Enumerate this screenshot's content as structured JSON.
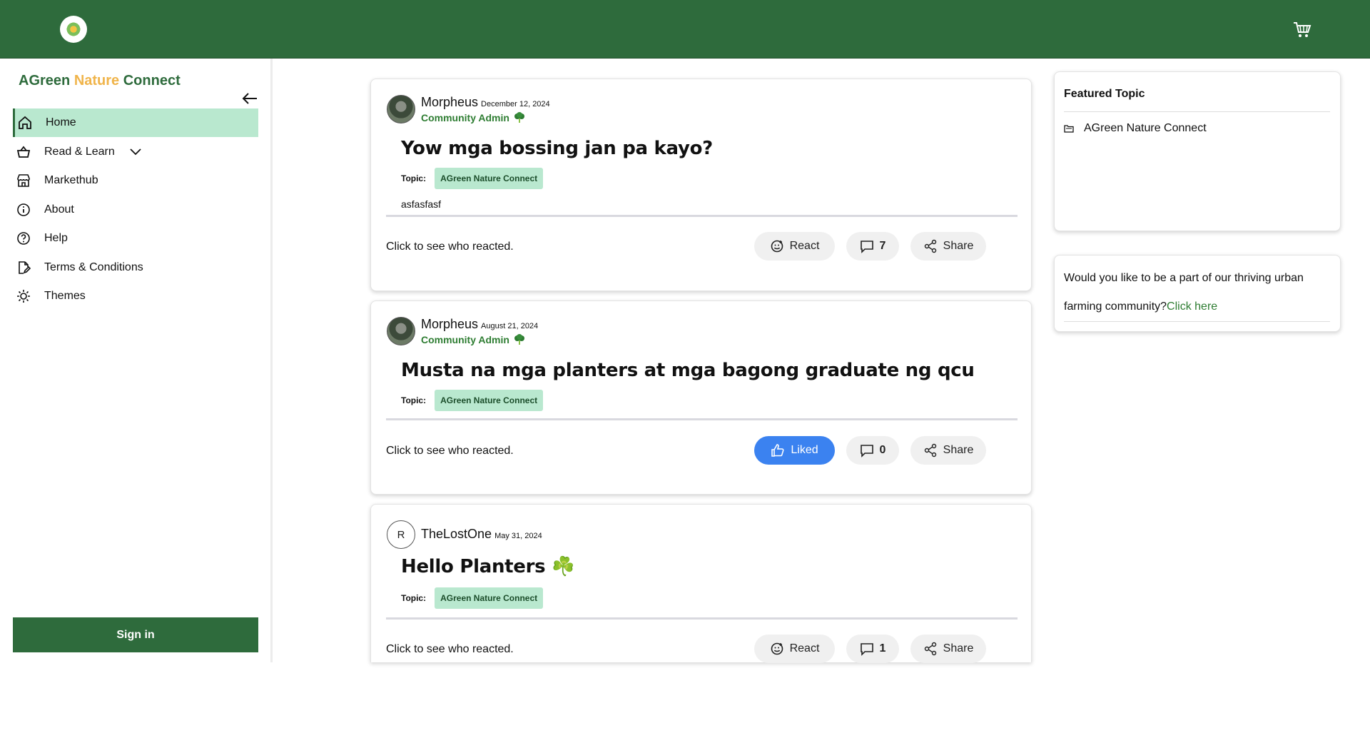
{
  "header": {
    "logo": "agreen-logo",
    "cart_icon": "cart-icon"
  },
  "sidebar": {
    "brand": {
      "part1": "AGreen",
      "part2": "Nature",
      "part3": "Connect"
    },
    "items": [
      {
        "label": "Home",
        "icon": "home-icon",
        "active": true
      },
      {
        "label": "Read & Learn",
        "icon": "basket-icon",
        "has_dropdown": true
      },
      {
        "label": "Markethub",
        "icon": "store-icon"
      },
      {
        "label": "About",
        "icon": "info-icon"
      },
      {
        "label": "Help",
        "icon": "help-icon"
      },
      {
        "label": "Terms & Conditions",
        "icon": "document-edit-icon"
      },
      {
        "label": "Themes",
        "icon": "sun-icon"
      }
    ],
    "signin_label": "Sign in"
  },
  "posts": [
    {
      "author": "Morpheus",
      "date": "December 12, 2024",
      "role": "Community Admin",
      "title": "Yow mga bossing jan pa kayo?",
      "topic_label": "Topic:",
      "topic": "AGreen Nature Connect",
      "body": "asfasfasf",
      "reacted_text": "Click to see who reacted.",
      "react_label": "React",
      "comment_count": "7",
      "share_label": "Share"
    },
    {
      "author": "Morpheus",
      "date": "August 21, 2024",
      "role": "Community Admin",
      "title": "Musta na mga planters at mga bagong graduate ng qcu",
      "topic_label": "Topic:",
      "topic": "AGreen Nature Connect",
      "reacted_text": "Click to see who reacted.",
      "react_label": "Liked",
      "comment_count": "0",
      "share_label": "Share"
    },
    {
      "author": "TheLostOne",
      "avatar_letter": "R",
      "date": "May 31, 2024",
      "title": "Hello Planters ☘️",
      "topic_label": "Topic:",
      "topic": "AGreen Nature Connect",
      "reacted_text": "Click to see who reacted.",
      "react_label": "React",
      "comment_count": "1",
      "share_label": "Share"
    }
  ],
  "featured": {
    "title": "Featured Topic",
    "item": "AGreen Nature Connect"
  },
  "join": {
    "text": "Would you like to be a part of our thriving urban farming community?",
    "link": "Click here"
  },
  "colors": {
    "primary": "#2e6b3c",
    "accent": "#f0b44a",
    "chip": "#b9e8cf",
    "liked": "#3b82f0"
  }
}
